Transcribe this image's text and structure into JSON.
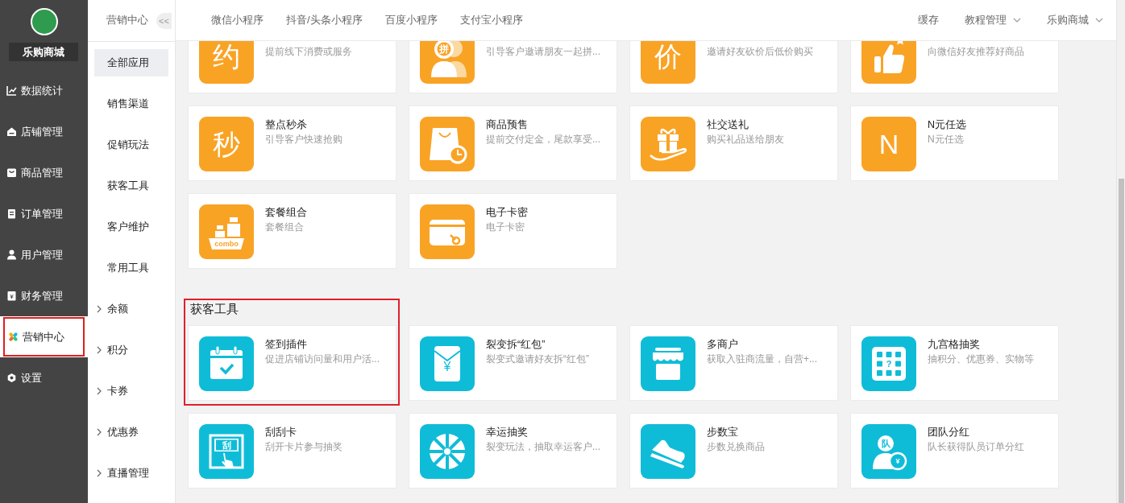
{
  "sidebar": {
    "shop_name": "乐购商城",
    "items": [
      {
        "label": "数据统计",
        "selected": false
      },
      {
        "label": "店铺管理",
        "selected": false
      },
      {
        "label": "商品管理",
        "selected": false
      },
      {
        "label": "订单管理",
        "selected": false
      },
      {
        "label": "用户管理",
        "selected": false
      },
      {
        "label": "财务管理",
        "selected": false
      },
      {
        "label": "营销中心",
        "selected": true
      },
      {
        "label": "设置",
        "selected": false
      }
    ]
  },
  "subnav": {
    "title": "营销中心",
    "collapse_button": "<<",
    "items": [
      {
        "label": "全部应用",
        "kind": "plain",
        "selected": true
      },
      {
        "label": "销售渠道",
        "kind": "plain",
        "selected": false
      },
      {
        "label": "促销玩法",
        "kind": "plain",
        "selected": false
      },
      {
        "label": "获客工具",
        "kind": "plain",
        "selected": false
      },
      {
        "label": "客户维护",
        "kind": "plain",
        "selected": false
      },
      {
        "label": "常用工具",
        "kind": "plain",
        "selected": false
      },
      {
        "label": "余额",
        "kind": "expandable",
        "selected": false
      },
      {
        "label": "积分",
        "kind": "expandable",
        "selected": false
      },
      {
        "label": "卡券",
        "kind": "expandable",
        "selected": false
      },
      {
        "label": "优惠券",
        "kind": "expandable",
        "selected": false
      },
      {
        "label": "直播管理",
        "kind": "expandable",
        "selected": false
      }
    ]
  },
  "header": {
    "tabs": [
      "微信小程序",
      "抖音/头条小程序",
      "百度小程序",
      "支付宝小程序"
    ],
    "actions": [
      {
        "label": "缓存",
        "dropdown": false
      },
      {
        "label": "教程管理",
        "dropdown": true
      },
      {
        "label": "乐购商城",
        "dropdown": true
      }
    ]
  },
  "app_groups": [
    {
      "apps": [
        {
          "desc": "提前线下消费或服务",
          "glyphs": [
            "约"
          ],
          "color": "#f9a325"
        },
        {
          "desc": "引导客户邀请朋友一起拼...",
          "glyphs": [
            "拼"
          ],
          "color": "#f9a325"
        },
        {
          "desc": "邀请好友砍价后低价购买",
          "glyphs": [
            "价"
          ],
          "color": "#f9a325"
        },
        {
          "desc": "向微信好友推荐好商品",
          "color": "#f9a325"
        },
        {
          "name": "整点秒杀",
          "desc": "引导客户快速抢购",
          "glyphs": [
            "秒"
          ],
          "color": "#f9a325"
        },
        {
          "name": "商品预售",
          "desc": "提前交付定金，尾款享受...",
          "color": "#f9a325"
        },
        {
          "name": "社交送礼",
          "desc": "购买礼品送给朋友",
          "color": "#f9a325"
        },
        {
          "name": "N元任选",
          "desc": "N元任选",
          "glyphs": [
            "N"
          ],
          "color": "#f9a325"
        },
        {
          "name": "套餐组合",
          "desc": "套餐组合",
          "glyphs": [
            "combo"
          ],
          "color": "#f9a325"
        },
        {
          "name": "电子卡密",
          "desc": "电子卡密",
          "color": "#f9a325"
        }
      ]
    },
    {
      "title": "获客工具",
      "highlighted": true,
      "apps": [
        {
          "name": "签到插件",
          "desc": "促进店铺访问量和用户活...",
          "color": "#0fbcd8"
        },
        {
          "name": "裂变拆“红包”",
          "desc": "裂变式邀请好友拆“红包”",
          "glyphs": [
            "¥"
          ],
          "color": "#0fbcd8"
        },
        {
          "name": "多商户",
          "desc": "获取入驻商流量，自营+...",
          "color": "#0fbcd8"
        },
        {
          "name": "九宫格抽奖",
          "desc": "抽积分、优惠券、实物等",
          "glyphs": [
            "?"
          ],
          "color": "#0fbcd8"
        },
        {
          "name": "刮刮卡",
          "desc": "刮开卡片参与抽奖",
          "glyphs": [
            "刮"
          ],
          "color": "#0fbcd8"
        },
        {
          "name": "幸运抽奖",
          "desc": "裂变玩法，抽取幸运客户...",
          "color": "#0fbcd8"
        },
        {
          "name": "步数宝",
          "desc": "步数兑换商品",
          "color": "#0fbcd8"
        },
        {
          "name": "团队分红",
          "desc": "队长获得队员订单分红",
          "glyphs": [
            "队",
            "¥"
          ],
          "color": "#0fbcd8"
        }
      ]
    }
  ]
}
